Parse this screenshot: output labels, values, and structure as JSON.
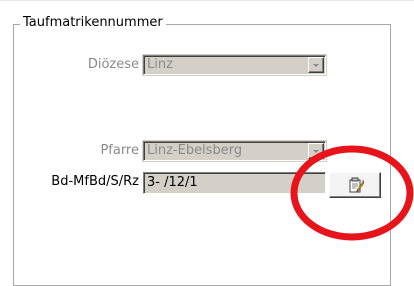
{
  "groupbox": {
    "title": "Taufmatrikennummer"
  },
  "dioezese": {
    "label": "Diözese",
    "value": "Linz"
  },
  "pfarre": {
    "label": "Pfarre",
    "value": "Linz-Ebelsberg"
  },
  "bdmfbd": {
    "label": "Bd-MfBd/S/Rz",
    "value": "3- /12/1"
  },
  "edit_button": {
    "icon": "notepad-pencil-icon"
  },
  "highlight": {
    "color": "#e8141c"
  }
}
